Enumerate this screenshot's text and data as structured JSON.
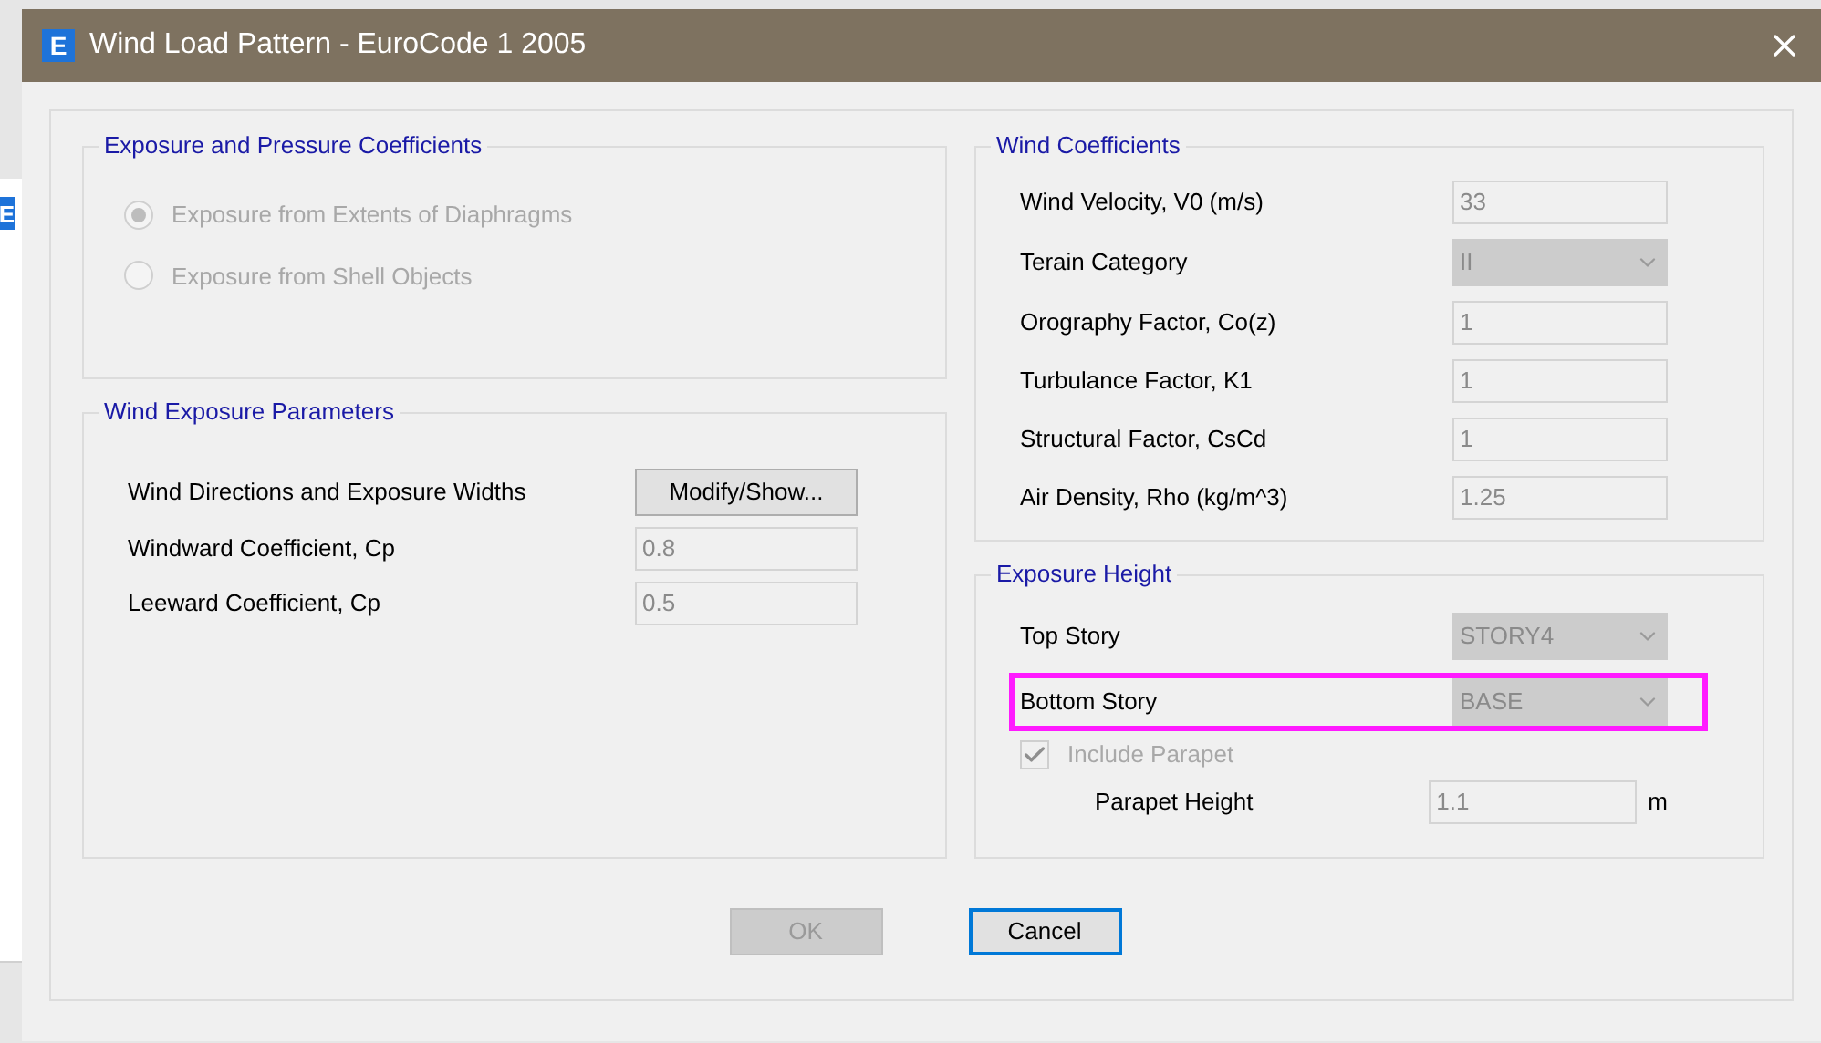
{
  "window": {
    "title": "Wind Load Pattern - EuroCode 1 2005",
    "app_icon": "E"
  },
  "background": {
    "app_icon": "E"
  },
  "exposure_and_pressure": {
    "title": "Exposure and Pressure Coefficients",
    "options": [
      {
        "label": "Exposure from Extents of Diaphragms",
        "selected": true,
        "disabled": true
      },
      {
        "label": "Exposure from Shell Objects",
        "selected": false,
        "disabled": true
      }
    ]
  },
  "wind_exposure_parameters": {
    "title": "Wind Exposure Parameters",
    "rows": [
      {
        "kind": "button",
        "label": "Wind Directions and Exposure Widths",
        "button": "Modify/Show..."
      },
      {
        "kind": "field",
        "label": "Windward Coefficient, Cp",
        "value": "0.8"
      },
      {
        "kind": "field",
        "label": "Leeward Coefficient, Cp",
        "value": "0.5"
      }
    ]
  },
  "wind_coefficients": {
    "title": "Wind Coefficients",
    "rows": [
      {
        "kind": "field",
        "label": "Wind Velocity, V0 (m/s)",
        "value": "33"
      },
      {
        "kind": "dropdown",
        "label": "Terain Category",
        "value": "II"
      },
      {
        "kind": "field",
        "label": "Orography Factor, Co(z)",
        "value": "1"
      },
      {
        "kind": "field",
        "label": "Turbulance Factor, K1",
        "value": "1"
      },
      {
        "kind": "field",
        "label": "Structural Factor, CsCd",
        "value": "1"
      },
      {
        "kind": "field",
        "label": "Air Density, Rho (kg/m^3)",
        "value": "1.25"
      }
    ]
  },
  "exposure_height": {
    "title": "Exposure Height",
    "rows": [
      {
        "kind": "dropdown",
        "label": "Top Story",
        "value": "STORY4",
        "highlighted": false
      },
      {
        "kind": "dropdown",
        "label": "Bottom Story",
        "value": "BASE",
        "highlighted": true
      }
    ],
    "include_parapet": {
      "label": "Include Parapet",
      "checked": true,
      "disabled": true
    },
    "parapet_height": {
      "label": "Parapet Height",
      "value": "1.1",
      "unit": "m"
    }
  },
  "buttons": [
    {
      "label": "OK",
      "disabled": true,
      "default": false
    },
    {
      "label": "Cancel",
      "disabled": false,
      "default": true
    }
  ]
}
